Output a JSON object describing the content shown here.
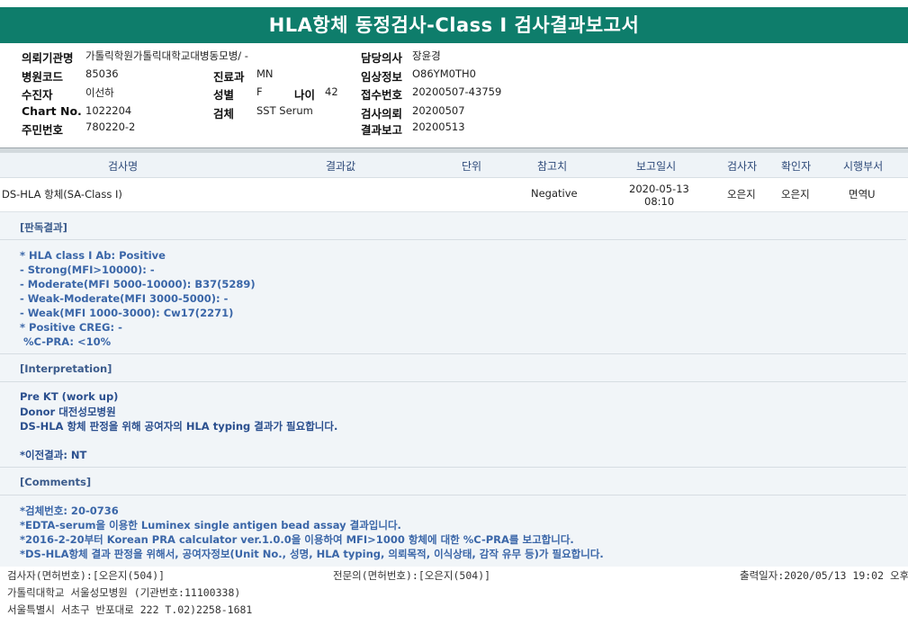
{
  "report": {
    "title": "HLA항체 동정검사-Class I 검사결과보고서"
  },
  "patient_info": {
    "institution_label": "의뢰기관명",
    "institution_value": "가톨릭학원가톨릭대학교대병동모병/ -",
    "hospital_code_label": "병원코드",
    "hospital_code_value": "85036",
    "collector_label": "수진자",
    "collector_value": "이선하",
    "chart_label": "Chart No.",
    "chart_value": "1022204",
    "resident_label": "주민번호",
    "resident_value": "780220-2",
    "dept_label": "진료과",
    "dept_value": "MN",
    "sex_label": "성별",
    "sex_value": "F",
    "age_label": "나이",
    "age_value": "42",
    "specimen_label": "검체",
    "specimen_value": "SST Serum",
    "doctor_label": "담당의사",
    "doctor_value": "장윤경",
    "clinical_label": "임상정보",
    "clinical_value": "O86YM0TH0",
    "receipt_label": "접수번호",
    "receipt_value": "20200507-43759",
    "request_label": "검사의뢰",
    "request_value": "20200507",
    "report_label": "결과보고",
    "report_value": "20200513"
  },
  "table": {
    "headers": [
      "검사명",
      "결과값",
      "단위",
      "참고치",
      "보고일시",
      "검사자",
      "확인자",
      "시행부서"
    ],
    "row": {
      "name": "DS-HLA 항체(SA-Class I)",
      "result": "",
      "unit": "",
      "reference": "Negative",
      "report_date": "2020-05-13",
      "report_time": "08:10",
      "tester": "오은지",
      "confirmer": "오은지",
      "department": "면역U"
    }
  },
  "sections": {
    "judgement_head": "[판독결과]",
    "judgement_lines": [
      "* HLA class I Ab: Positive",
      "- Strong(MFI>10000): -",
      "- Moderate(MFI 5000-10000): B37(5289)",
      "- Weak-Moderate(MFI 3000-5000): -",
      "- Weak(MFI 1000-3000): Cw17(2271)",
      "* Positive CREG: -",
      " %C-PRA: <10%"
    ],
    "interpretation_head": "[Interpretation]",
    "interpretation_lines": [
      "Pre KT (work up)",
      "Donor 대전성모병원",
      "DS-HLA 항체 판정을 위해 공여자의 HLA typing 결과가 필요합니다.",
      "",
      "*이전결과: NT"
    ],
    "comments_head": "[Comments]",
    "comments_lines": [
      "*검체번호: 20-0736",
      "*EDTA-serum을 이용한 Luminex single antigen bead assay 결과입니다.",
      "*2016-2-20부터 Korean PRA calculator ver.1.0.0을 이용하여 MFI>1000 항체에 대한 %C-PRA를 보고합니다.",
      "*DS-HLA항체 결과 판정을 위해서, 공여자정보(Unit No., 성명, HLA typing, 의뢰목적, 이식상태, 감작 유무 등)가 필요합니다."
    ]
  },
  "footer": {
    "tester": "검사자(면허번호):[오은지(504)]",
    "specialist": "전문의(면허번호):[오은지(504)]",
    "print_date": "출력일자:2020/05/13 19:02 오후",
    "hospital": "가톨릭대학교 서울성모병원 (기관번호:11100338)",
    "address": "서울특별시 서초구 반포대로 222 T.02)2258-1681"
  }
}
